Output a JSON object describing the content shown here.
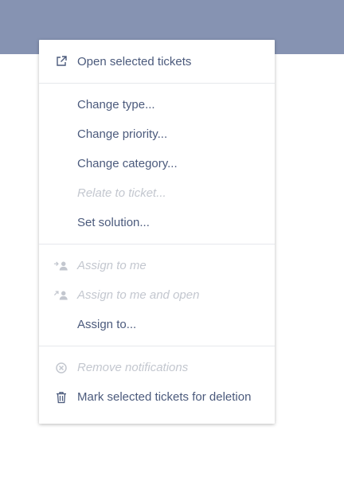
{
  "colors": {
    "header": "#8693b2",
    "text": "#4b5a7c",
    "disabled_text": "#c3c7cf",
    "separator": "#e6e8ec"
  },
  "menu": {
    "groups": [
      {
        "items": [
          {
            "label": "Open selected tickets",
            "icon": "external-link-icon",
            "enabled": true
          }
        ]
      },
      {
        "items": [
          {
            "label": "Change type...",
            "icon": null,
            "enabled": true
          },
          {
            "label": "Change priority...",
            "icon": null,
            "enabled": true
          },
          {
            "label": "Change category...",
            "icon": null,
            "enabled": true
          },
          {
            "label": "Relate to ticket...",
            "icon": null,
            "enabled": false
          },
          {
            "label": "Set solution...",
            "icon": null,
            "enabled": true
          }
        ]
      },
      {
        "items": [
          {
            "label": "Assign to me",
            "icon": "assign-to-me-icon",
            "enabled": false
          },
          {
            "label": "Assign to me and open",
            "icon": "assign-and-open-icon",
            "enabled": false
          },
          {
            "label": "Assign to...",
            "icon": null,
            "enabled": true
          }
        ]
      },
      {
        "items": [
          {
            "label": "Remove notifications",
            "icon": "remove-notifications-icon",
            "enabled": false
          },
          {
            "label": "Mark selected tickets for deletion",
            "icon": "trash-icon",
            "enabled": true
          }
        ]
      }
    ]
  }
}
